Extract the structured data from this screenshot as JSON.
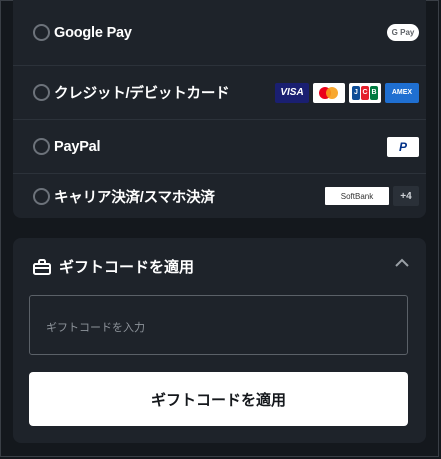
{
  "payment_methods": [
    {
      "label": "Google Pay",
      "logos": [
        "G Pay"
      ]
    },
    {
      "label": "クレジット/デビットカード",
      "logos": [
        "VISA",
        "JCB",
        "AMEX"
      ]
    },
    {
      "label": "PayPal",
      "logos": [
        "P"
      ]
    },
    {
      "label": "キャリア決済/スマホ決済",
      "logos": [
        "SoftBank",
        "+4"
      ]
    }
  ],
  "gift": {
    "title": "ギフトコードを適用",
    "input_placeholder": "ギフトコードを入力",
    "apply_button": "ギフトコードを適用"
  },
  "colors": {
    "background": "#14181d",
    "panel": "#1e232a",
    "visa": "#1a1f71",
    "mastercard_red": "#eb001b",
    "mastercard_yellow": "#f79e1b",
    "amex": "#1f6fd1",
    "paypal": "#003087"
  },
  "icons": {
    "gift": "gift-box-icon",
    "collapse": "chevron-up-icon"
  }
}
